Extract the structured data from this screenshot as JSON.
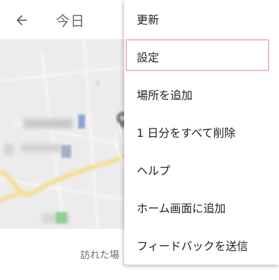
{
  "header": {
    "back_icon": "arrow-back-icon",
    "title": "今日"
  },
  "bottom": {
    "visited_text": "訪れた場"
  },
  "menu": {
    "items": [
      {
        "label": "更新"
      },
      {
        "label": "設定",
        "highlighted": true
      },
      {
        "label": "場所を追加"
      },
      {
        "label": "1 日分をすべて削除"
      },
      {
        "label": "ヘルプ"
      },
      {
        "label": "ホーム画面に追加"
      },
      {
        "label": "フィードバックを送信"
      }
    ]
  },
  "colors": {
    "highlight_border": "#f2b7cf",
    "map_background": "#ececec",
    "road": "#f4df9c",
    "park": "#8fcf8f",
    "poi_blue": "#8da2d6"
  }
}
